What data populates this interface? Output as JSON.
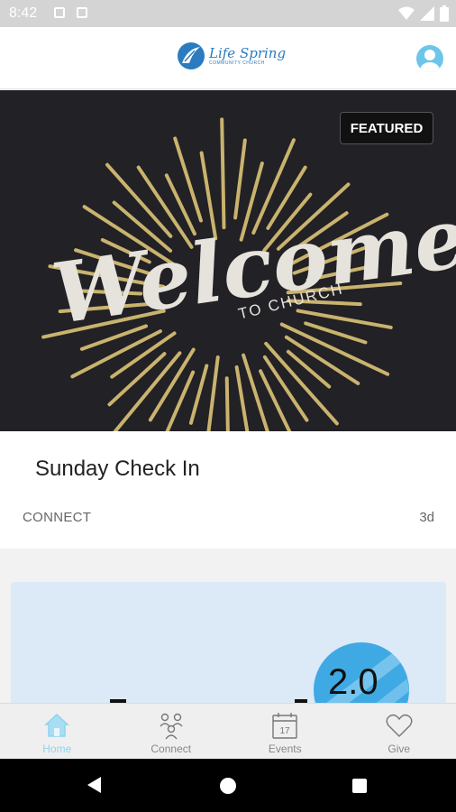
{
  "status_bar": {
    "time": "8:42"
  },
  "header": {
    "logo_name": "Life Spring",
    "logo_subtitle": "COMMUNITY CHURCH",
    "brand_color": "#2a7bc0"
  },
  "featured_card": {
    "badge": "FEATURED",
    "title": "Sunday Check In",
    "category": "CONNECT",
    "age": "3d",
    "hero_headline": "Welcome",
    "hero_subheadline": "TO CHURCH"
  },
  "second_card": {
    "badge_text": "2.0"
  },
  "bottom_nav": {
    "items": [
      {
        "label": "Home",
        "icon": "home-icon",
        "active": true
      },
      {
        "label": "Connect",
        "icon": "people-icon",
        "active": false
      },
      {
        "label": "Events",
        "icon": "calendar-icon",
        "active": false,
        "icon_text": "17"
      },
      {
        "label": "Give",
        "icon": "heart-icon",
        "active": false
      }
    ]
  },
  "colors": {
    "accent": "#8fd3f0",
    "hero_bg": "#222125",
    "ray_gold": "#c9b36e"
  }
}
